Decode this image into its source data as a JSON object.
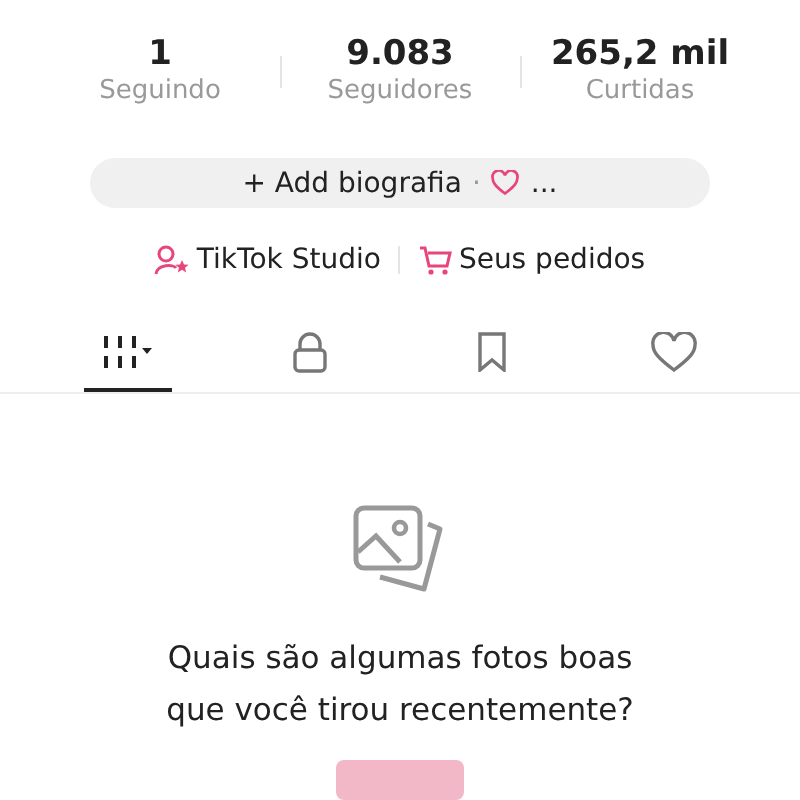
{
  "stats": [
    {
      "value": "1",
      "label": "Seguindo"
    },
    {
      "value": "9.083",
      "label": "Seguidores"
    },
    {
      "value": "265,2 mil",
      "label": "Curtidas"
    }
  ],
  "bio_button": {
    "plus": "+",
    "label": "Add biografia",
    "separator": "·",
    "ellipsis": "..."
  },
  "links": [
    {
      "kind": "studio",
      "label": "TikTok Studio"
    },
    {
      "kind": "orders",
      "label": "Seus pedidos"
    }
  ],
  "tabs": [
    {
      "kind": "grid",
      "selected": true
    },
    {
      "kind": "private",
      "selected": false
    },
    {
      "kind": "saved",
      "selected": false
    },
    {
      "kind": "liked",
      "selected": false
    }
  ],
  "empty_state": {
    "message": "Quais são algumas fotos boas que você tirou recentemente?"
  }
}
